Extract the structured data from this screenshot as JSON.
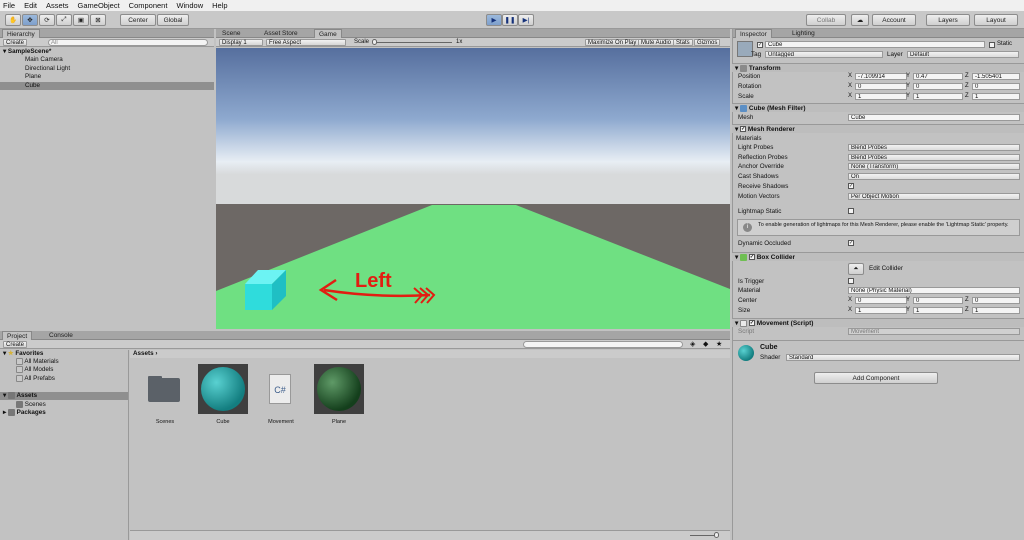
{
  "menu": [
    "File",
    "Edit",
    "Assets",
    "GameObject",
    "Component",
    "Window",
    "Help"
  ],
  "toolbar": {
    "center": "Center",
    "global": "Global",
    "collab": "Collab",
    "account": "Account",
    "layers": "Layers",
    "layout": "Layout"
  },
  "hierarchy": {
    "tab": "Hierarchy",
    "create": "Create",
    "search": "All",
    "scene": "SampleScene*",
    "items": [
      "Main Camera",
      "Directional Light",
      "Plane",
      "Cube"
    ]
  },
  "game": {
    "tabs": [
      "Scene",
      "Asset Store",
      "Game"
    ],
    "display": "Display 1",
    "aspect": "Free Aspect",
    "scale": "Scale",
    "scale_val": "1x",
    "maximize": "Maximize On Play",
    "mute": "Mute Audio",
    "stats": "Stats",
    "gizmos": "Gizmos",
    "annotation": "Left"
  },
  "project": {
    "tabs": [
      "Project",
      "Console"
    ],
    "create": "Create",
    "favorites": "Favorites",
    "fav_items": [
      "All Materials",
      "All Models",
      "All Prefabs"
    ],
    "assets": "Assets",
    "asset_sub": [
      "Scenes"
    ],
    "packages": "Packages",
    "breadcrumb": "Assets",
    "files": [
      "Scenes",
      "Cube",
      "Movement",
      "Plane"
    ],
    "cs": "C#"
  },
  "inspector": {
    "tabs": [
      "Inspector",
      "Lighting"
    ],
    "name": "Cube",
    "static": "Static",
    "tag_label": "Tag",
    "tag": "Untagged",
    "layer_label": "Layer",
    "layer": "Default",
    "transform": {
      "title": "Transform",
      "rows": [
        {
          "label": "Position",
          "x": "-7.109914",
          "y": "0.47",
          "z": "-1.505401"
        },
        {
          "label": "Rotation",
          "x": "0",
          "y": "0",
          "z": "0"
        },
        {
          "label": "Scale",
          "x": "1",
          "y": "1",
          "z": "1"
        }
      ]
    },
    "mesh_filter": {
      "title": "Cube (Mesh Filter)",
      "mesh_label": "Mesh",
      "mesh": "Cube"
    },
    "mesh_renderer": {
      "title": "Mesh Renderer",
      "materials": "Materials",
      "rows": [
        {
          "label": "Light Probes",
          "value": "Blend Probes"
        },
        {
          "label": "Reflection Probes",
          "value": "Blend Probes"
        },
        {
          "label": "Anchor Override",
          "value": "None (Transform)"
        },
        {
          "label": "Cast Shadows",
          "value": "On"
        },
        {
          "label": "Receive Shadows",
          "value": "✓"
        },
        {
          "label": "Motion Vectors",
          "value": "Per Object Motion"
        }
      ],
      "lightmap": "Lightmap Static",
      "info": "To enable generation of lightmaps for this Mesh Renderer, please enable the 'Lightmap Static' property.",
      "dynamic": "Dynamic Occluded"
    },
    "box_collider": {
      "title": "Box Collider",
      "edit": "Edit Collider",
      "is_trigger": "Is Trigger",
      "material_label": "Material",
      "material": "None (Physic Material)",
      "center_label": "Center",
      "center": {
        "x": "0",
        "y": "0",
        "z": "0"
      },
      "size_label": "Size",
      "size": {
        "x": "1",
        "y": "1",
        "z": "1"
      }
    },
    "movement": {
      "title": "Movement (Script)",
      "script_label": "Script",
      "script": "Movement"
    },
    "material": {
      "name": "Cube",
      "shader_label": "Shader",
      "shader": "Standard"
    },
    "add_component": "Add Component"
  }
}
